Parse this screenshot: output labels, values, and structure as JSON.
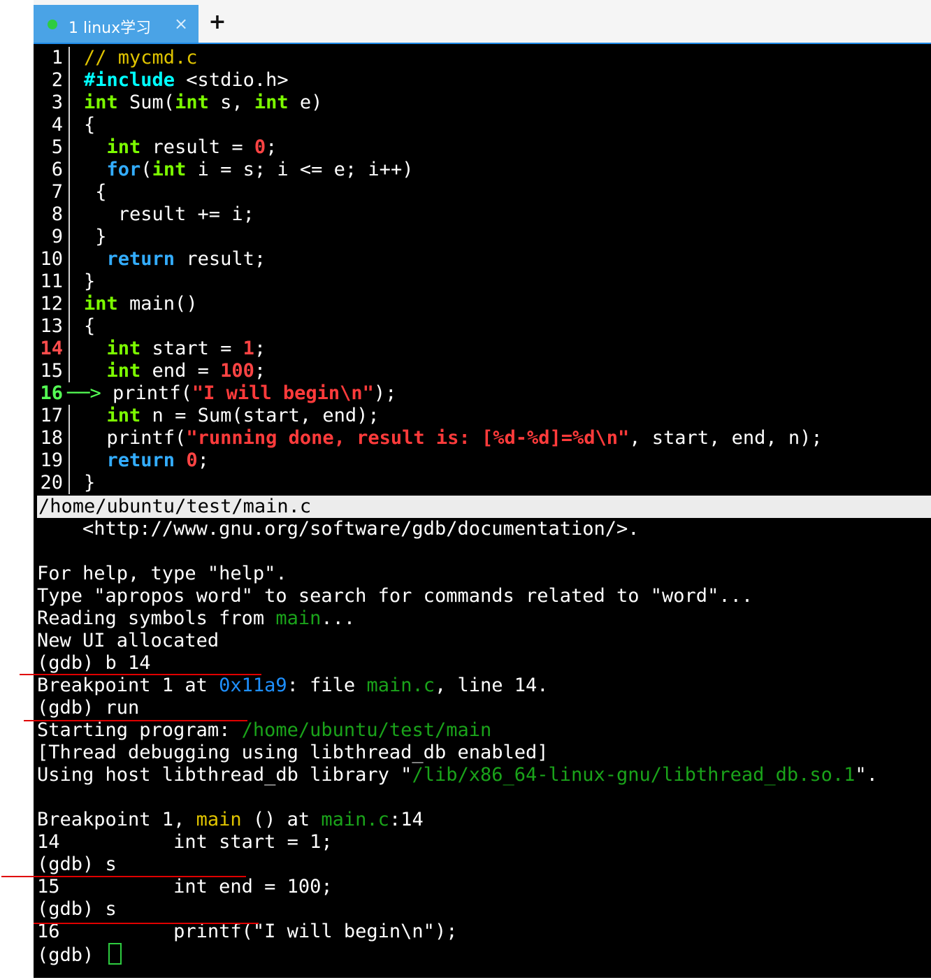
{
  "tab": {
    "label": "1 linux学习",
    "close": "×",
    "new_tab": "+",
    "status_color": "#2ecc40"
  },
  "source": {
    "lines": [
      {
        "n": "1",
        "parts": [
          [
            "cmt",
            "// mycmd.c"
          ]
        ]
      },
      {
        "n": "2",
        "parts": [
          [
            "pp",
            "#include"
          ],
          [
            "",
            " <stdio.h>"
          ]
        ]
      },
      {
        "n": "3",
        "parts": [
          [
            "kw",
            "int"
          ],
          [
            "",
            " Sum("
          ],
          [
            "kw",
            "int"
          ],
          [
            "",
            " s, "
          ],
          [
            "kw",
            "int"
          ],
          [
            "",
            " e)"
          ]
        ]
      },
      {
        "n": "4",
        "parts": [
          [
            "",
            "{"
          ]
        ]
      },
      {
        "n": "5",
        "parts": [
          [
            "",
            "  "
          ],
          [
            "kw",
            "int"
          ],
          [
            "",
            " result = "
          ],
          [
            "num-lit",
            "0"
          ],
          [
            "",
            ";"
          ]
        ]
      },
      {
        "n": "6",
        "parts": [
          [
            "",
            "  "
          ],
          [
            "ctrl",
            "for"
          ],
          [
            "",
            "("
          ],
          [
            "kw",
            "int"
          ],
          [
            "",
            " i = s; i <= e; i++)"
          ]
        ]
      },
      {
        "n": "7",
        "parts": [
          [
            "",
            " {"
          ]
        ]
      },
      {
        "n": "8",
        "parts": [
          [
            "",
            "   result += i;"
          ]
        ]
      },
      {
        "n": "9",
        "parts": [
          [
            "",
            " }"
          ]
        ]
      },
      {
        "n": "10",
        "parts": [
          [
            "",
            "  "
          ],
          [
            "ctrl",
            "return"
          ],
          [
            "",
            " result;"
          ]
        ]
      },
      {
        "n": "11",
        "parts": [
          [
            "",
            "}"
          ]
        ]
      },
      {
        "n": "12",
        "parts": [
          [
            "kw",
            "int"
          ],
          [
            "",
            " main()"
          ]
        ]
      },
      {
        "n": "13",
        "parts": [
          [
            "",
            "{"
          ]
        ]
      },
      {
        "n": "14",
        "mark": "breakpoint",
        "parts": [
          [
            "",
            "  "
          ],
          [
            "kw",
            "int"
          ],
          [
            "",
            " start = "
          ],
          [
            "num-lit",
            "1"
          ],
          [
            "",
            ";"
          ]
        ]
      },
      {
        "n": "15",
        "parts": [
          [
            "",
            "  "
          ],
          [
            "kw",
            "int"
          ],
          [
            "",
            " end = "
          ],
          [
            "num-lit",
            "100"
          ],
          [
            "",
            ";"
          ]
        ]
      },
      {
        "n": "16",
        "mark": "current",
        "arrow": "──>",
        "parts": [
          [
            "",
            " printf("
          ],
          [
            "str",
            "\"I will begin\\n\""
          ],
          [
            "",
            ");"
          ]
        ]
      },
      {
        "n": "17",
        "parts": [
          [
            "",
            "  "
          ],
          [
            "kw",
            "int"
          ],
          [
            "",
            " n = Sum(start, end);"
          ]
        ]
      },
      {
        "n": "18",
        "parts": [
          [
            "",
            "  printf("
          ],
          [
            "str",
            "\"running done, result is: [%d-%d]=%d\\n\""
          ],
          [
            "",
            ", start, end, n);"
          ]
        ]
      },
      {
        "n": "19",
        "parts": [
          [
            "",
            "  "
          ],
          [
            "ctrl",
            "return"
          ],
          [
            "",
            " "
          ],
          [
            "num-lit",
            "0"
          ],
          [
            "",
            ";"
          ]
        ]
      },
      {
        "n": "20",
        "parts": [
          [
            "",
            "}"
          ]
        ]
      }
    ]
  },
  "status_bar": "/home/ubuntu/test/main.c",
  "gdb": {
    "lines": [
      [
        [
          "",
          "    <http://www.gnu.org/software/gdb/documentation/>."
        ]
      ],
      [
        [
          "",
          ""
        ]
      ],
      [
        [
          "",
          "For help, type \"help\"."
        ]
      ],
      [
        [
          "",
          "Type \"apropos word\" to search for commands related to \"word\"..."
        ]
      ],
      [
        [
          "",
          "Reading symbols from "
        ],
        [
          "grn",
          "main"
        ],
        [
          "",
          "..."
        ]
      ],
      [
        [
          "",
          "New UI allocated"
        ]
      ],
      [
        [
          "",
          "(gdb) b 14"
        ]
      ],
      [
        [
          "",
          "Breakpoint 1 at "
        ],
        [
          "blu",
          "0x11a9"
        ],
        [
          "",
          ": file "
        ],
        [
          "grn",
          "main.c"
        ],
        [
          "",
          ", line 14."
        ]
      ],
      [
        [
          "",
          "(gdb) run"
        ]
      ],
      [
        [
          "",
          "Starting program: "
        ],
        [
          "grn",
          "/home/ubuntu/test/main"
        ]
      ],
      [
        [
          "",
          "[Thread debugging using libthread_db enabled]"
        ]
      ],
      [
        [
          "",
          "Using host libthread_db library \""
        ],
        [
          "grn",
          "/lib/x86_64-linux-gnu/libthread_db.so.1"
        ],
        [
          "",
          "\"."
        ]
      ],
      [
        [
          "",
          ""
        ]
      ],
      [
        [
          "",
          "Breakpoint 1, "
        ],
        [
          "ylw",
          "main"
        ],
        [
          "",
          " () at "
        ],
        [
          "grn",
          "main.c"
        ],
        [
          "",
          ":14"
        ]
      ],
      [
        [
          "",
          "14          int start = 1;"
        ]
      ],
      [
        [
          "",
          "(gdb) s"
        ]
      ],
      [
        [
          "",
          "15          int end = 100;"
        ]
      ],
      [
        [
          "",
          "(gdb) s"
        ]
      ],
      [
        [
          "",
          "16          printf(\"I will begin\\n\");"
        ]
      ],
      [
        [
          "",
          "(gdb) "
        ]
      ]
    ]
  }
}
